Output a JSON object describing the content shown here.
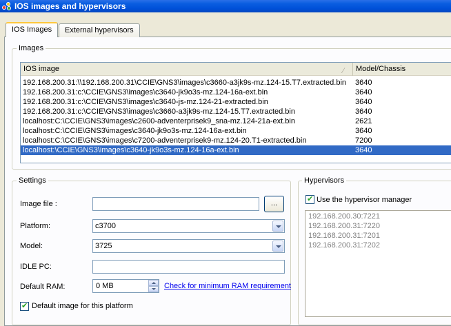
{
  "window": {
    "title": "IOS images and hypervisors"
  },
  "tabs": [
    {
      "label": "IOS Images",
      "active": true
    },
    {
      "label": "External hypervisors",
      "active": false
    }
  ],
  "images_group": {
    "title": "Images",
    "columns": [
      "IOS image",
      "Model/Chassis"
    ],
    "rows": [
      {
        "image": "192.168.200.31:\\\\192.168.200.31\\CCIE\\GNS3\\images\\c3660-a3jk9s-mz.124-15.T7.extracted.bin",
        "model": "3640"
      },
      {
        "image": "192.168.200.31:c:\\CCIE\\GNS3\\images\\c3640-jk9o3s-mz.124-16a-ext.bin",
        "model": "3640"
      },
      {
        "image": "192.168.200.31:c:\\CCIE\\GNS3\\images\\c3640-js-mz.124-21-extracted.bin",
        "model": "3640"
      },
      {
        "image": "192.168.200.31:c:\\CCIE\\GNS3\\images\\c3660-a3jk9s-mz.124-15.T7.extracted.bin",
        "model": "3640"
      },
      {
        "image": "localhost:C:\\CCIE\\GNS3\\images\\c2600-adventerprisek9_sna-mz.124-21a-ext.bin",
        "model": "2621"
      },
      {
        "image": "localhost:C:\\CCIE\\GNS3\\images\\c3640-jk9o3s-mz.124-16a-ext.bin",
        "model": "3640"
      },
      {
        "image": "localhost:C:\\CCIE\\GNS3\\images\\c7200-adventerprisek9-mz.124-20.T1-extracted.bin",
        "model": "7200"
      },
      {
        "image": "localhost:\\CCIE\\GNS3\\images\\c3640-jk9o3s-mz.124-16a-ext.bin",
        "model": "3640",
        "selected": true
      }
    ]
  },
  "settings": {
    "title": "Settings",
    "image_file_label": "Image file :",
    "image_file_value": "",
    "browse_label": "...",
    "platform_label": "Platform:",
    "platform_value": "c3700",
    "model_label": "Model:",
    "model_value": "3725",
    "idle_pc_label": "IDLE PC:",
    "idle_pc_value": "",
    "ram_label": "Default RAM:",
    "ram_value": "0 MB",
    "ram_link": "Check for minimum RAM requirement",
    "default_image_label": "Default image for this platform",
    "default_image_checked": true
  },
  "hypervisors": {
    "title": "Hypervisors",
    "use_manager_label": "Use the hypervisor manager",
    "use_manager_checked": true,
    "items": [
      "192.168.200.30:7221",
      "192.168.200.31:7220",
      "192.168.200.31:7201",
      "192.168.200.31:7202"
    ]
  }
}
